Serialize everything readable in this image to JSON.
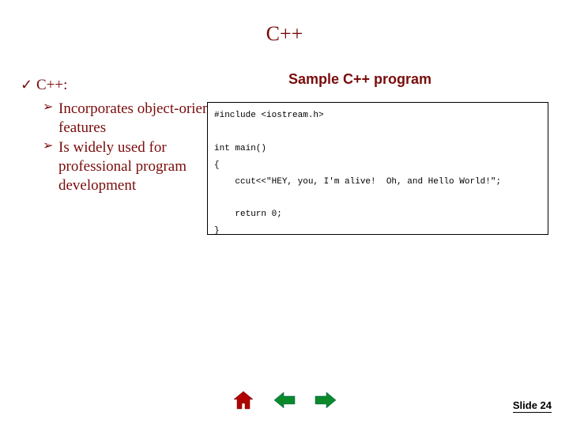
{
  "title": "C++",
  "sample_label": "Sample C++ program",
  "bullets": {
    "lvl1": {
      "marker": "✓",
      "text": "C++:"
    },
    "lvl2": [
      {
        "marker": "➢",
        "text": "Incorporates object-oriented features"
      },
      {
        "marker": "➢",
        "text": "Is widely used for professional program development"
      }
    ]
  },
  "code_lines": [
    "#include <iostream.h>",
    "",
    "int main()",
    "{",
    "    ccut<<\"HEY, you, I'm alive!  Oh, and Hello World!\";",
    "",
    "    return 0;",
    "}"
  ],
  "slide_number_label": "Slide 24",
  "nav": {
    "home_title": "Home",
    "prev_title": "Previous",
    "next_title": "Next"
  },
  "colors": {
    "accent": "#7a0c0c",
    "home_fill": "#b00000",
    "arrow_fill": "#0a8a2a"
  }
}
